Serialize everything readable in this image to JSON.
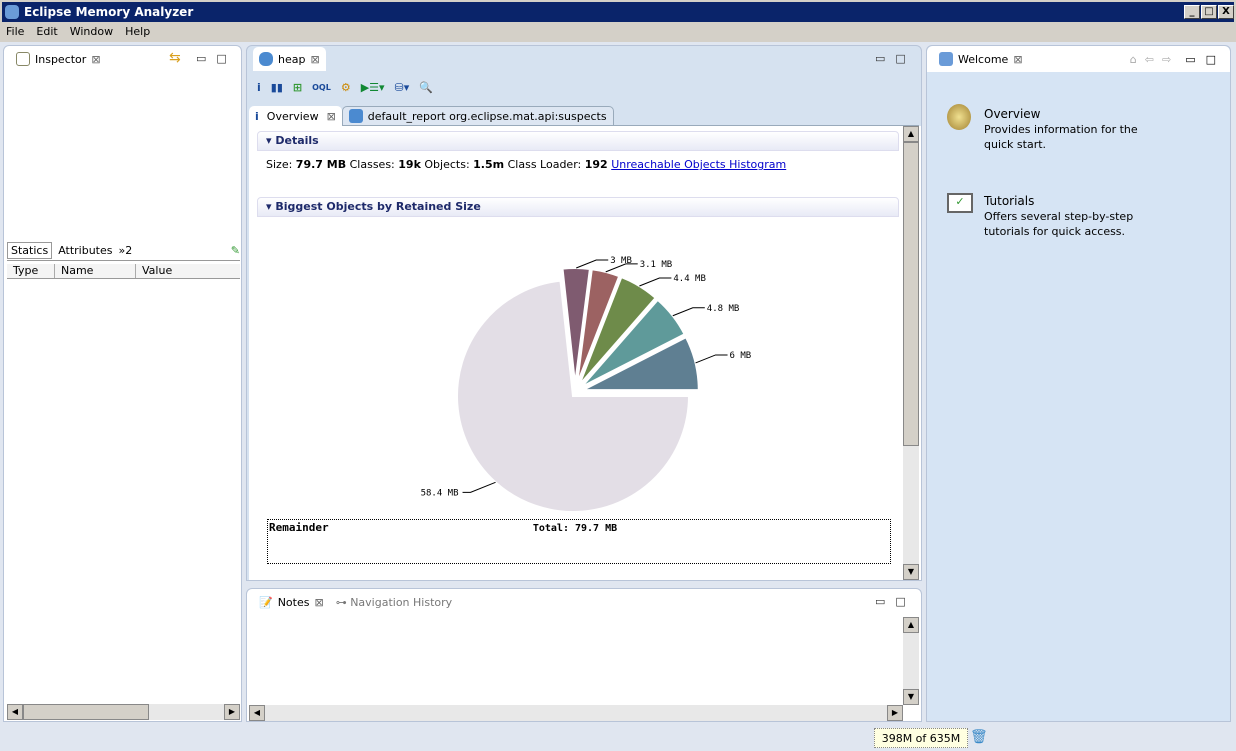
{
  "window": {
    "title": "Eclipse Memory Analyzer",
    "min": "_",
    "max": "□",
    "close": "X"
  },
  "menu": [
    "File",
    "Edit",
    "Window",
    "Help"
  ],
  "inspector": {
    "tab": "Inspector",
    "subtabs": [
      "Statics",
      "Attributes",
      "»2"
    ],
    "columns": [
      "Type",
      "Name",
      "Value"
    ]
  },
  "editor": {
    "tab": "heap",
    "subtabs": [
      "Overview",
      "default_report  org.eclipse.mat.api:suspects"
    ],
    "details_title": "Details",
    "details": {
      "size_label": "Size:",
      "size": "79.7 MB",
      "classes_label": "Classes:",
      "classes": "19k",
      "objects_label": "Objects:",
      "objects": "1.5m",
      "loader_label": "Class Loader:",
      "loader": "192",
      "link": "Unreachable Objects Histogram"
    },
    "biggest_title": "Biggest Objects by Retained Size",
    "remainder": "Remainder"
  },
  "chart_data": {
    "type": "pie",
    "title": "Biggest Objects by Retained Size",
    "total_label": "Total:  79.7 MB",
    "slices": [
      {
        "label": "6 MB",
        "value": 6,
        "color": "#5f7f92"
      },
      {
        "label": "4.8 MB",
        "value": 4.8,
        "color": "#5f9a9a"
      },
      {
        "label": "4.4 MB",
        "value": 4.4,
        "color": "#6e8b4a"
      },
      {
        "label": "3.1 MB",
        "value": 3.1,
        "color": "#9c6262"
      },
      {
        "label": "3 MB",
        "value": 3,
        "color": "#7f5b70"
      },
      {
        "label": "58.4 MB",
        "value": 58.4,
        "color": "#e3dee6"
      }
    ]
  },
  "notes": {
    "tab": "Notes",
    "tab2": "Navigation History"
  },
  "welcome": {
    "tab": "Welcome",
    "items": [
      {
        "title": "Overview",
        "desc": "Provides information for the quick start."
      },
      {
        "title": "Tutorials",
        "desc": "Offers several step-by-step tutorials for quick access."
      }
    ]
  },
  "status": {
    "heap": "398M of 635M"
  }
}
